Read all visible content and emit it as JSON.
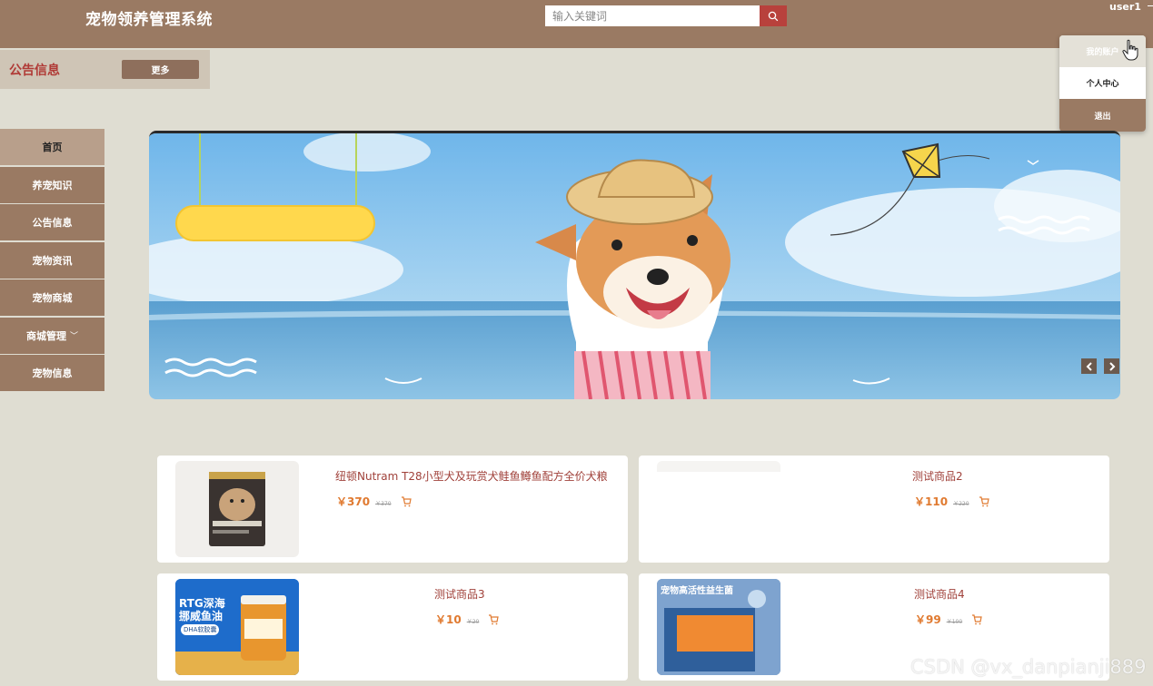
{
  "header": {
    "app_title": "宠物领养管理系统",
    "search_placeholder": "输入关键词",
    "username": "user1"
  },
  "user_menu": {
    "items": [
      "我的账户",
      "个人中心",
      "退出"
    ]
  },
  "notice": {
    "title": "公告信息",
    "more_label": "更多"
  },
  "sidebar": {
    "items": [
      {
        "label": "首页",
        "active": true
      },
      {
        "label": "养宠知识"
      },
      {
        "label": "公告信息"
      },
      {
        "label": "宠物资讯"
      },
      {
        "label": "宠物商城"
      },
      {
        "label": "商城管理",
        "has_submenu": true
      },
      {
        "label": "宠物信息"
      }
    ]
  },
  "products": [
    {
      "name": "纽顿Nutram T28小型犬及玩赏犬鲑鱼鳟鱼配方全价犬粮",
      "price": "￥370",
      "original_price": "￥370"
    },
    {
      "name": "测试商品2",
      "price": "￥110",
      "original_price": "￥220"
    },
    {
      "name": "测试商品3",
      "price": "￥10",
      "original_price": "￥20"
    },
    {
      "name": "测试商品4",
      "price": "￥99",
      "original_price": "￥100"
    }
  ],
  "product_images": {
    "p3_line1": "RTG深海",
    "p3_line2": "挪威鱼油",
    "p3_tag": "DHA软胶囊",
    "p4_title": "宠物高活性益生菌"
  },
  "colors": {
    "header_bg": "#9a7a63",
    "accent_red": "#b8413c",
    "price_orange": "#e07a30",
    "page_bg": "#dfddd2"
  },
  "watermark": "CSDN @vx_danpianji889"
}
